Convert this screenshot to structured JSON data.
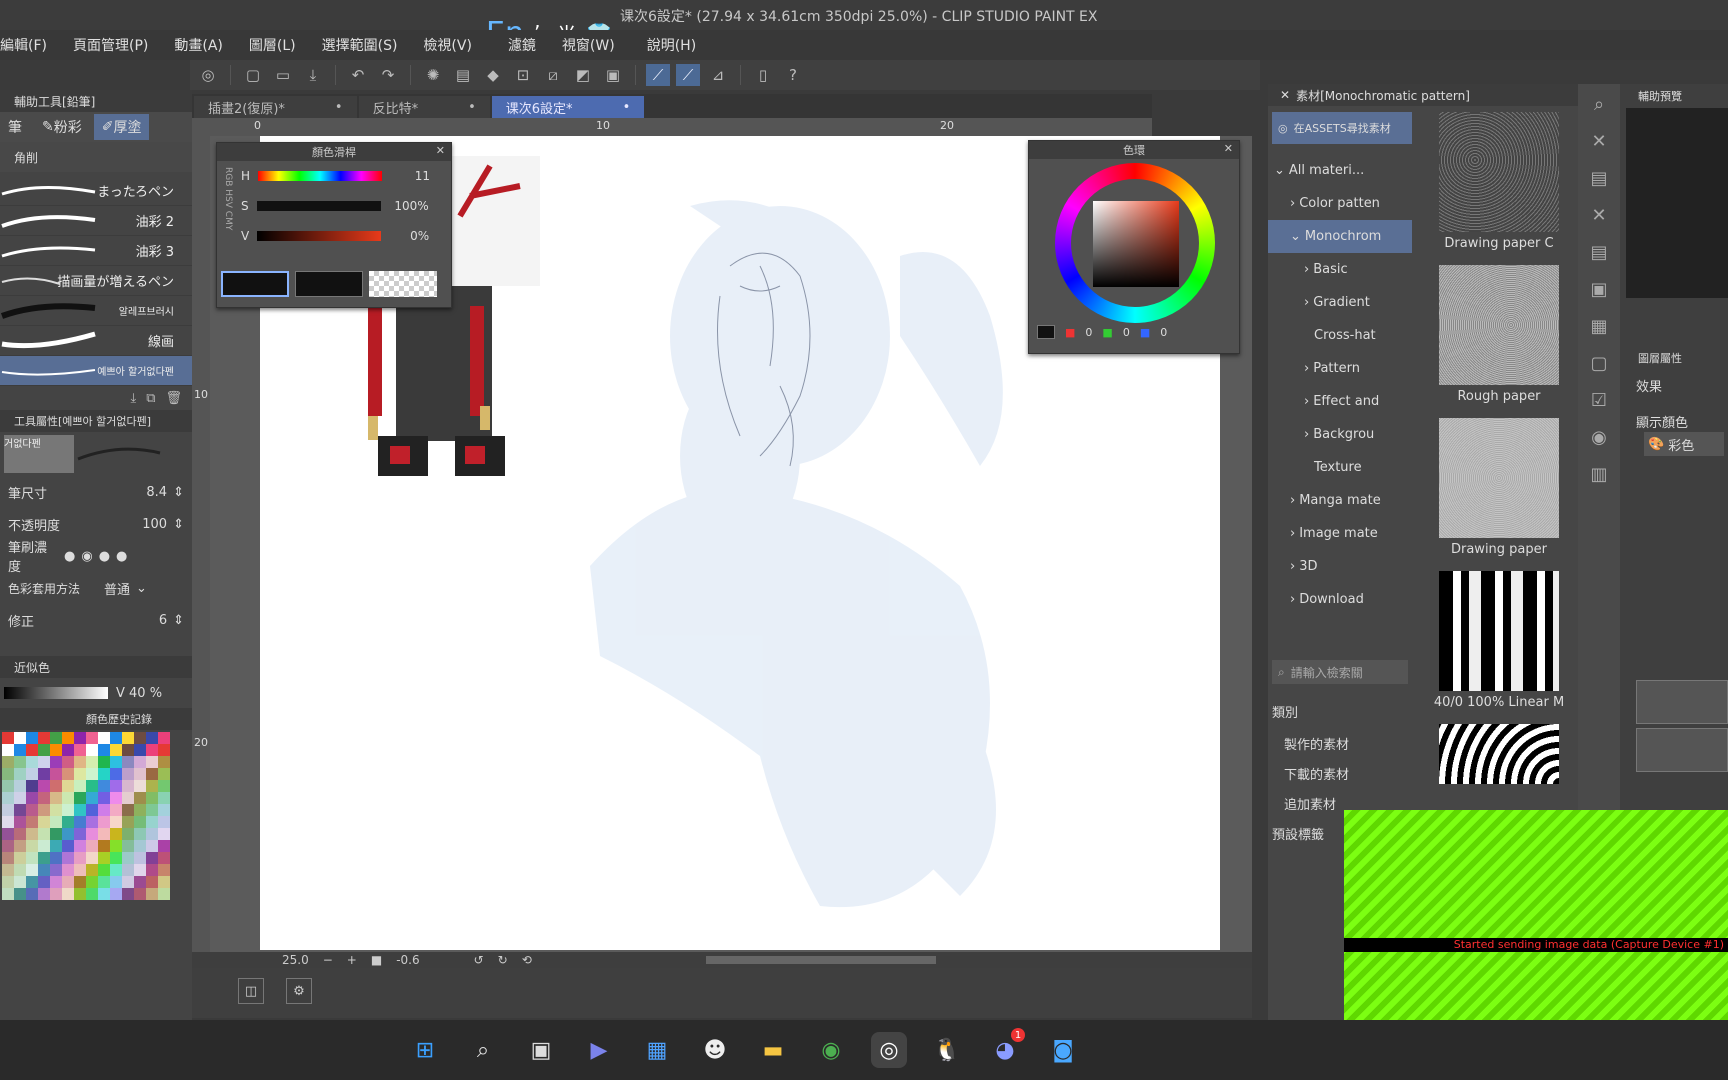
{
  "window": {
    "title": "课次6設定* (27.94 x 34.61cm 350dpi 25.0%) - CLIP STUDIO PAINT EX"
  },
  "ime": {
    "lang": "En",
    "half": "半"
  },
  "menu": [
    "編輯(F)",
    "頁面管理(P)",
    "動畫(A)",
    "圖層(L)",
    "選擇範圍(S)",
    "檢視(V)",
    "濾鏡",
    "視窗(W)",
    "說明(H)"
  ],
  "left_panel": {
    "header": "輔助工具[鉛筆]",
    "subtabs": [
      "筆",
      "粉彩",
      "厚塗"
    ],
    "subheader": "角削",
    "brushes": [
      "まったろペン",
      "油彩 2",
      "油彩 3",
      "描画量が増えるペン",
      "알레프브러시",
      "線画",
      "예쁘아 할거없다펜"
    ],
    "props_header": "工具屬性[예쁘아 할거없다펜]",
    "preview_label": "거없다펜",
    "props": [
      {
        "label": "筆尺寸",
        "value": "8.4"
      },
      {
        "label": "不透明度",
        "value": "100"
      },
      {
        "label": "筆刷濃度",
        "value": ""
      },
      {
        "label": "色彩套用方法",
        "value": "普通"
      },
      {
        "label": "修正",
        "value": "6"
      }
    ],
    "color_tab": "近似色",
    "v_label": "V 40 %",
    "history_tab": "顏色歷史記錄"
  },
  "tabs": [
    {
      "label": "插畫2(復原)*"
    },
    {
      "label": "反比特*"
    },
    {
      "label": "课次6設定*"
    }
  ],
  "ruler": {
    "t0": "0",
    "t10": "10",
    "t20": "20",
    "l10": "10",
    "l20": "20"
  },
  "status": {
    "zoom": "25.0",
    "angle": "-0.6"
  },
  "color_slider": {
    "title": "顏色滑桿",
    "h_label": "H",
    "h_value": "11",
    "s_label": "S",
    "s_value": "100%",
    "v_label": "V",
    "v_value": "0%",
    "modes": [
      "RGB",
      "HSV",
      "CMY"
    ]
  },
  "color_wheel": {
    "title": "色環",
    "r": "0",
    "g": "0",
    "b": "0"
  },
  "material": {
    "header": "素材[Monochromatic pattern]",
    "assets_btn": "在ASSETS尋找素材",
    "tree": [
      "All materi...",
      "Color patten",
      "Monochrom",
      "Basic",
      "Gradient",
      "Cross-hat",
      "Pattern",
      "Effect and",
      "Backgrou",
      "Texture",
      "Manga mate",
      "Image mate",
      "3D",
      "Download"
    ],
    "search_placeholder": "請輸入檢索關",
    "category_label": "類別",
    "buttons": [
      "製作的素材",
      "下載的素材",
      "追加素材"
    ],
    "preset_label": "預設標籤",
    "thumbs": [
      "Drawing paper C",
      "Rough paper",
      "Drawing paper",
      "40/0 100% Linear M",
      ""
    ]
  },
  "right": {
    "nav_label": "輔助預覽",
    "effect": "效果",
    "display_color": "顯示顏色",
    "color_mode": "彩色",
    "layer_label": "圖層屬性"
  },
  "overlay": {
    "text": "Started sending image data (Capture Device #1)"
  },
  "taskbar": [
    "windows-start",
    "search",
    "task-view",
    "teams",
    "store",
    "alien",
    "explorer",
    "chrome",
    "clip-studio",
    "qq",
    "discord",
    "app"
  ],
  "discord_badge": "1",
  "colors": {
    "accent": "#4d6bb0",
    "panel": "#444444",
    "green": "#7cff12"
  }
}
